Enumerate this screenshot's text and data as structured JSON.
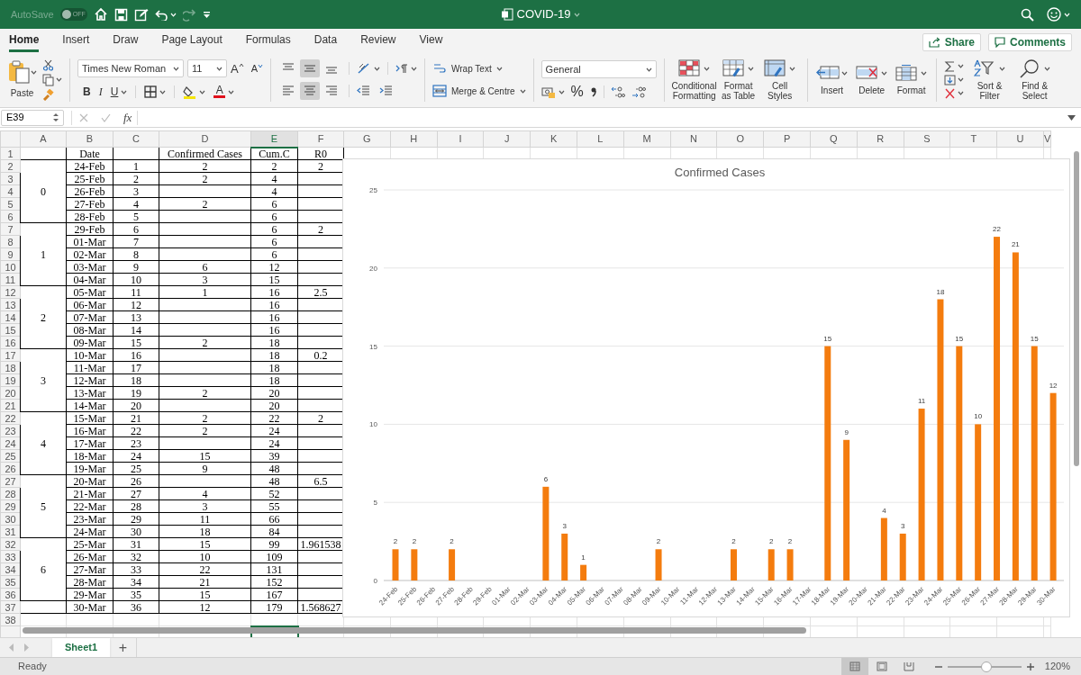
{
  "title_bar": {
    "autosave_label": "AutoSave",
    "autosave_state": "OFF",
    "autosave_on": false,
    "document_title": "COVID-19"
  },
  "menu_tabs": [
    {
      "label": "Home",
      "selected": true
    },
    {
      "label": "Insert",
      "selected": false
    },
    {
      "label": "Draw",
      "selected": false
    },
    {
      "label": "Page Layout",
      "selected": false
    },
    {
      "label": "Formulas",
      "selected": false
    },
    {
      "label": "Data",
      "selected": false
    },
    {
      "label": "Review",
      "selected": false
    },
    {
      "label": "View",
      "selected": false
    }
  ],
  "share_button": "Share",
  "comments_button": "Comments",
  "ribbon": {
    "paste": "Paste",
    "font_name": "Times New Roman",
    "font_size": "11",
    "grow_font": "A",
    "shrink_font": "A",
    "bold": "B",
    "italic": "I",
    "underline": "U",
    "font_color": "A",
    "vertical_align": [
      {
        "selected": false
      },
      {
        "selected": true
      },
      {
        "selected": false
      }
    ],
    "horizontal_align": [
      {
        "selected": false
      },
      {
        "selected": true
      },
      {
        "selected": false
      }
    ],
    "wrap_text": "Wrap Text",
    "merge": "Merge & Centre",
    "number_format": "General",
    "percent": "%",
    "style_buttons": [
      {
        "kind": "conditional",
        "label": "Conditional Formatting"
      },
      {
        "kind": "table",
        "label": "Format as Table"
      },
      {
        "kind": "styles",
        "label": "Cell Styles"
      }
    ],
    "cell_buttons": [
      {
        "kind": "insert",
        "label": "Insert"
      },
      {
        "kind": "delete",
        "label": "Delete"
      },
      {
        "kind": "format",
        "label": "Format"
      }
    ],
    "edit_buttons": [
      {
        "kind": "sort",
        "label": "Sort & Filter"
      },
      {
        "kind": "find",
        "label": "Find & Select"
      }
    ]
  },
  "formula_bar": {
    "name_box": "E39",
    "fx": "fx"
  },
  "columns": [
    {
      "label": "A",
      "selected": false
    },
    {
      "label": "B",
      "selected": false
    },
    {
      "label": "C",
      "selected": false
    },
    {
      "label": "D",
      "selected": false
    },
    {
      "label": "E",
      "selected": true
    },
    {
      "label": "F",
      "selected": false
    },
    {
      "label": "G",
      "selected": false
    },
    {
      "label": "H",
      "selected": false
    },
    {
      "label": "I",
      "selected": false
    },
    {
      "label": "J",
      "selected": false
    },
    {
      "label": "K",
      "selected": false
    },
    {
      "label": "L",
      "selected": false
    },
    {
      "label": "M",
      "selected": false
    },
    {
      "label": "N",
      "selected": false
    },
    {
      "label": "O",
      "selected": false
    },
    {
      "label": "P",
      "selected": false
    },
    {
      "label": "Q",
      "selected": false
    },
    {
      "label": "R",
      "selected": false
    },
    {
      "label": "S",
      "selected": false
    },
    {
      "label": "T",
      "selected": false
    },
    {
      "label": "U",
      "selected": false
    },
    {
      "label": "V",
      "selected": false
    }
  ],
  "row_numbers": [
    "1",
    "2",
    "3",
    "4",
    "5",
    "6",
    "7",
    "8",
    "9",
    "10",
    "11",
    "12",
    "13",
    "14",
    "15",
    "16",
    "17",
    "18",
    "19",
    "20",
    "21",
    "22",
    "23",
    "24",
    "25",
    "26",
    "27",
    "28",
    "29",
    "30",
    "31",
    "32",
    "33",
    "34",
    "35",
    "36",
    "37",
    "38"
  ],
  "header_row": {
    "date": "Date",
    "confirmed": "Confirmed Cases",
    "cum": "Cum.C",
    "r0": "R0"
  },
  "groups": [
    {
      "week": "0",
      "rows": [
        {
          "date": "24-Feb",
          "col_c": "1",
          "confirmed": "2",
          "cum": "2",
          "r0": "2"
        },
        {
          "date": "25-Feb",
          "col_c": "2",
          "confirmed": "2",
          "cum": "4"
        },
        {
          "date": "26-Feb",
          "col_c": "3",
          "cum": "4"
        },
        {
          "date": "27-Feb",
          "col_c": "4",
          "confirmed": "2",
          "cum": "6"
        },
        {
          "date": "28-Feb",
          "col_c": "5",
          "cum": "6"
        }
      ]
    },
    {
      "week": "1",
      "rows": [
        {
          "date": "29-Feb",
          "col_c": "6",
          "cum": "6",
          "r0": "2"
        },
        {
          "date": "01-Mar",
          "col_c": "7",
          "cum": "6"
        },
        {
          "date": "02-Mar",
          "col_c": "8",
          "cum": "6"
        },
        {
          "date": "03-Mar",
          "col_c": "9",
          "confirmed": "6",
          "cum": "12"
        },
        {
          "date": "04-Mar",
          "col_c": "10",
          "confirmed": "3",
          "cum": "15"
        }
      ]
    },
    {
      "week": "2",
      "rows": [
        {
          "date": "05-Mar",
          "col_c": "11",
          "confirmed": "1",
          "cum": "16",
          "r0": "2.5"
        },
        {
          "date": "06-Mar",
          "col_c": "12",
          "cum": "16"
        },
        {
          "date": "07-Mar",
          "col_c": "13",
          "cum": "16"
        },
        {
          "date": "08-Mar",
          "col_c": "14",
          "cum": "16"
        },
        {
          "date": "09-Mar",
          "col_c": "15",
          "confirmed": "2",
          "cum": "18"
        }
      ]
    },
    {
      "week": "3",
      "rows": [
        {
          "date": "10-Mar",
          "col_c": "16",
          "cum": "18",
          "r0": "0.2"
        },
        {
          "date": "11-Mar",
          "col_c": "17",
          "cum": "18"
        },
        {
          "date": "12-Mar",
          "col_c": "18",
          "cum": "18"
        },
        {
          "date": "13-Mar",
          "col_c": "19",
          "confirmed": "2",
          "cum": "20"
        },
        {
          "date": "14-Mar",
          "col_c": "20",
          "cum": "20"
        }
      ]
    },
    {
      "week": "4",
      "rows": [
        {
          "date": "15-Mar",
          "col_c": "21",
          "confirmed": "2",
          "cum": "22",
          "r0": "2"
        },
        {
          "date": "16-Mar",
          "col_c": "22",
          "confirmed": "2",
          "cum": "24"
        },
        {
          "date": "17-Mar",
          "col_c": "23",
          "cum": "24"
        },
        {
          "date": "18-Mar",
          "col_c": "24",
          "confirmed": "15",
          "cum": "39"
        },
        {
          "date": "19-Mar",
          "col_c": "25",
          "confirmed": "9",
          "cum": "48"
        }
      ]
    },
    {
      "week": "5",
      "rows": [
        {
          "date": "20-Mar",
          "col_c": "26",
          "cum": "48",
          "r0": "6.5"
        },
        {
          "date": "21-Mar",
          "col_c": "27",
          "confirmed": "4",
          "cum": "52"
        },
        {
          "date": "22-Mar",
          "col_c": "28",
          "confirmed": "3",
          "cum": "55"
        },
        {
          "date": "23-Mar",
          "col_c": "29",
          "confirmed": "11",
          "cum": "66"
        },
        {
          "date": "24-Mar",
          "col_c": "30",
          "confirmed": "18",
          "cum": "84"
        }
      ]
    },
    {
      "week": "6",
      "rows": [
        {
          "date": "25-Mar",
          "col_c": "31",
          "confirmed": "15",
          "cum": "99",
          "r0": "1.961538"
        },
        {
          "date": "26-Mar",
          "col_c": "32",
          "confirmed": "10",
          "cum": "109"
        },
        {
          "date": "27-Mar",
          "col_c": "33",
          "confirmed": "22",
          "cum": "131"
        },
        {
          "date": "28-Mar",
          "col_c": "34",
          "confirmed": "21",
          "cum": "152"
        },
        {
          "date": "29-Mar",
          "col_c": "35",
          "confirmed": "15",
          "cum": "167"
        }
      ]
    },
    {
      "rows": [
        {
          "date": "30-Mar",
          "col_c": "36",
          "confirmed": "12",
          "cum": "179",
          "r0": "1.568627"
        }
      ]
    }
  ],
  "chart": {
    "chart_data": {
      "type": "bar",
      "title": "Confirmed Cases",
      "categories": [
        "24-Feb",
        "25-Feb",
        "26-Feb",
        "27-Feb",
        "28-Feb",
        "29-Feb",
        "01-Mar",
        "02-Mar",
        "03-Mar",
        "04-Mar",
        "05-Mar",
        "06-Mar",
        "07-Mar",
        "08-Mar",
        "09-Mar",
        "10-Mar",
        "11-Mar",
        "12-Mar",
        "13-Mar",
        "14-Mar",
        "15-Mar",
        "16-Mar",
        "17-Mar",
        "18-Mar",
        "19-Mar",
        "20-Mar",
        "21-Mar",
        "22-Mar",
        "23-Mar",
        "24-Mar",
        "25-Mar",
        "26-Mar",
        "27-Mar",
        "28-Mar",
        "29-Mar",
        "30-Mar"
      ],
      "series": [
        {
          "color": "#f47c0e",
          "values": [
            2,
            2,
            null,
            2,
            null,
            null,
            null,
            null,
            6,
            3,
            1,
            null,
            null,
            null,
            2,
            null,
            null,
            null,
            2,
            null,
            2,
            2,
            null,
            15,
            9,
            null,
            4,
            3,
            11,
            18,
            15,
            10,
            22,
            21,
            15,
            12
          ]
        }
      ],
      "ylim": [
        0,
        25
      ],
      "grid": true,
      "yticks": [
        0,
        5,
        10,
        15,
        20,
        25
      ],
      "data_labels": true
    }
  },
  "sheet_tabs": [
    {
      "label": "Sheet1",
      "selected": true
    }
  ],
  "add_sheet": "+",
  "status_bar": {
    "status": "Ready",
    "views": [
      {
        "kind": "normal",
        "selected": true
      },
      {
        "kind": "page_layout",
        "selected": false
      },
      {
        "kind": "page_break",
        "selected": false
      }
    ],
    "zoom_slider": {
      "level": 0.53
    },
    "zoom": "120%"
  }
}
